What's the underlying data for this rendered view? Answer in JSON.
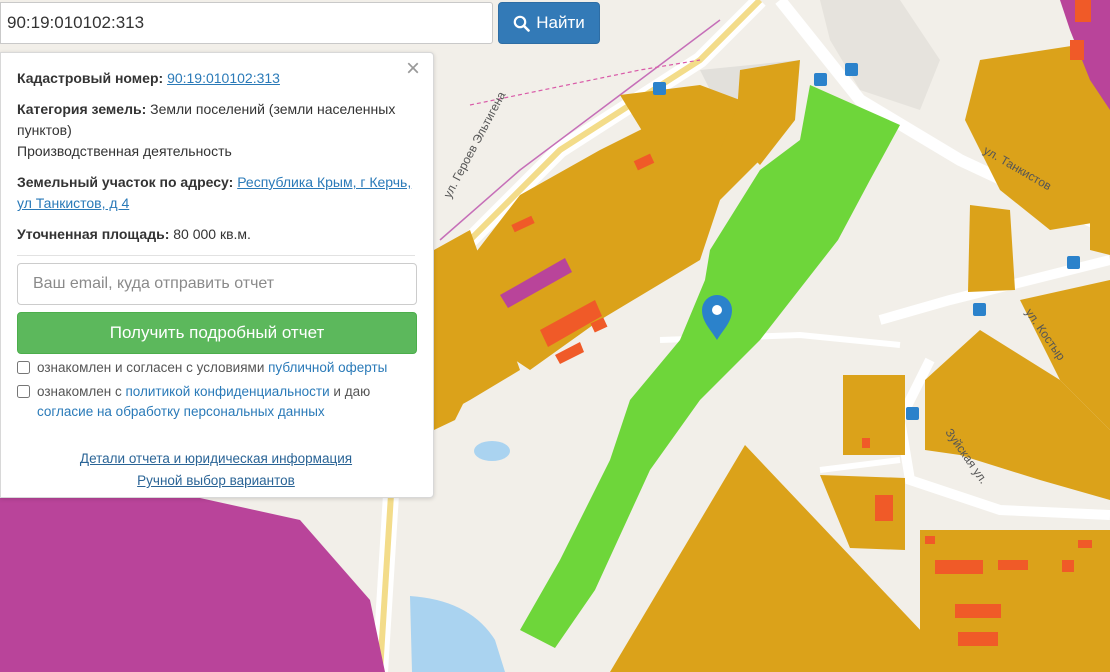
{
  "search": {
    "value": "90:19:010102:313",
    "button_label": "Найти"
  },
  "panel": {
    "cadastral_label": "Кадастровый номер:",
    "cadastral_value": "90:19:010102:313",
    "category_label": "Категория земель:",
    "category_value": "Земли поселений (земли населенных пунктов)",
    "use_value": "Производственная деятельность",
    "address_label": "Земельный участок по адресу:",
    "address_value": "Республика Крым, г Керчь, ул Танкистов, д 4",
    "area_label": "Уточненная площадь:",
    "area_value": "80 000 кв.м.",
    "email_placeholder": "Ваш email, куда отправить отчет",
    "report_button": "Получить подробный отчет",
    "consent1_prefix": "ознакомлен и согласен с условиями",
    "consent1_link": "публичной оферты",
    "consent2_prefix": "ознакомлен с",
    "consent2_link1": "политикой конфиденциальности",
    "consent2_mid": "и даю",
    "consent2_link2": "согласие на обработку персональных данных",
    "details_link": "Детали отчета и юридическая информация",
    "manual_link": "Ручной выбор вариантов"
  },
  "map": {
    "street_labels": [
      "ул. Героев Эльтигена",
      "ул. Танкистов",
      "ул. Костыр",
      "Зуйская ул."
    ],
    "colors": {
      "parcel_orange": "#dba21a",
      "parcel_green": "#6ed63a",
      "parcel_purple": "#b9449a",
      "building_red": "#f05a28",
      "water": "#aad3f0",
      "marker": "#2b82cb"
    }
  }
}
